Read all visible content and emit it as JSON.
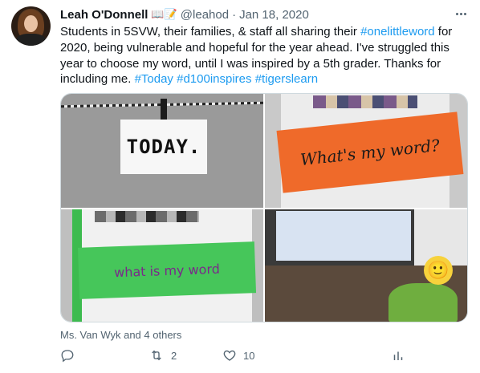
{
  "tweet": {
    "author_name": "Leah O'Donnell",
    "name_emojis": "📖📝",
    "handle": "@leahod",
    "separator": "·",
    "date": "Jan 18, 2020",
    "text_segments": [
      {
        "text": "Students in 5SVW, their families, & staff all sharing their  ",
        "type": "text"
      },
      {
        "text": "#onelittleword",
        "type": "tag"
      },
      {
        "text": " for 2020, being vulnerable and hopeful for the year ahead. I've struggled this year to choose my word, until I was inspired by a 5th grader.  Thanks for including me. ",
        "type": "text"
      },
      {
        "text": "#Today",
        "type": "tag"
      },
      {
        "text": " ",
        "type": "text"
      },
      {
        "text": "#d100inspires",
        "type": "tag"
      },
      {
        "text": " ",
        "type": "text"
      },
      {
        "text": "#tigerslearn",
        "type": "tag"
      }
    ]
  },
  "media": {
    "img1_text": "TODAY.",
    "img2_text": "What's my word?",
    "img3_text": "what is my word",
    "img4_emoji": "🙂"
  },
  "likers_text": "Ms. Van Wyk and 4 others",
  "actions": {
    "reply_icon": "reply-icon",
    "retweet_count": "2",
    "like_count": "10"
  },
  "colors": {
    "link": "#1d9bf0",
    "secondary": "#536471",
    "border": "#cfd9de"
  }
}
